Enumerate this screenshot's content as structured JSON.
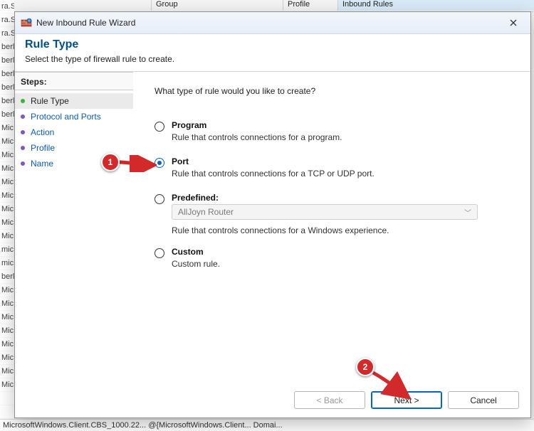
{
  "background": {
    "columns": {
      "group": "Group",
      "profile": "Profile",
      "inbound": "Inbound Rules"
    },
    "left_fragments": [
      "ra.S",
      "ra.S",
      "ra.S",
      "berl",
      "berl",
      "berl",
      "berl",
      "berl",
      "berl",
      "Mic",
      "Mic",
      "Mic",
      "Mic",
      "Mic",
      "Mic",
      "Mic",
      "Mic",
      "Mic",
      "mic",
      "mic",
      "berl",
      "Mic",
      "Mic",
      "Mic",
      "Mic",
      "Mic",
      "Mic",
      "Mic",
      "Mic"
    ],
    "status": "MicrosoftWindows.Client.CBS_1000.22...   @{MicrosoftWindows.Client...   Domai..."
  },
  "dialog": {
    "title": "New Inbound Rule Wizard",
    "heading": "Rule Type",
    "subtitle": "Select the type of firewall rule to create.",
    "steps_header": "Steps:",
    "steps": [
      {
        "label": "Rule Type",
        "state": "active",
        "current": true
      },
      {
        "label": "Protocol and Ports",
        "state": "inactive",
        "current": false
      },
      {
        "label": "Action",
        "state": "inactive",
        "current": false
      },
      {
        "label": "Profile",
        "state": "inactive",
        "current": false
      },
      {
        "label": "Name",
        "state": "inactive",
        "current": false
      }
    ],
    "question": "What type of rule would you like to create?",
    "options": {
      "program": {
        "label": "Program",
        "desc": "Rule that controls connections for a program."
      },
      "port": {
        "label": "Port",
        "desc": "Rule that controls connections for a TCP or UDP port."
      },
      "predefined": {
        "label": "Predefined:",
        "selected": "AllJoyn Router",
        "desc": "Rule that controls connections for a Windows experience."
      },
      "custom": {
        "label": "Custom",
        "desc": "Custom rule."
      }
    },
    "selected_option": "port",
    "buttons": {
      "back": "< Back",
      "next": "Next >",
      "cancel": "Cancel"
    }
  },
  "annotations": {
    "bubble1": "1",
    "bubble2": "2"
  }
}
